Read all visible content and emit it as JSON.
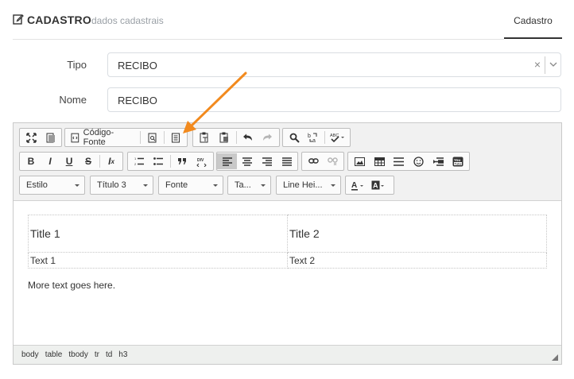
{
  "header": {
    "title": "CADASTRO",
    "subtitle": "dados cadastrais",
    "tab": "Cadastro"
  },
  "form": {
    "tipo": {
      "label": "Tipo",
      "value": "RECIBO",
      "clear": "×"
    },
    "nome": {
      "label": "Nome",
      "value": "RECIBO"
    }
  },
  "toolbar": {
    "source_label": "Código-Fonte",
    "combos": {
      "style": "Estilo",
      "format": "Título 3",
      "font": "Fonte",
      "size": "Ta...",
      "line_height": "Line Hei..."
    }
  },
  "content": {
    "table": {
      "headers": [
        "Title 1",
        "Title 2"
      ],
      "cells": [
        "Text 1",
        "Text 2"
      ]
    },
    "paragraph": "More text goes here."
  },
  "statusbar": {
    "path": [
      "body",
      "table",
      "tbody",
      "tr",
      "td",
      "h3"
    ]
  },
  "colors": {
    "annotation_arrow": "#f28a1e",
    "active_tab_underline": "#333333"
  }
}
